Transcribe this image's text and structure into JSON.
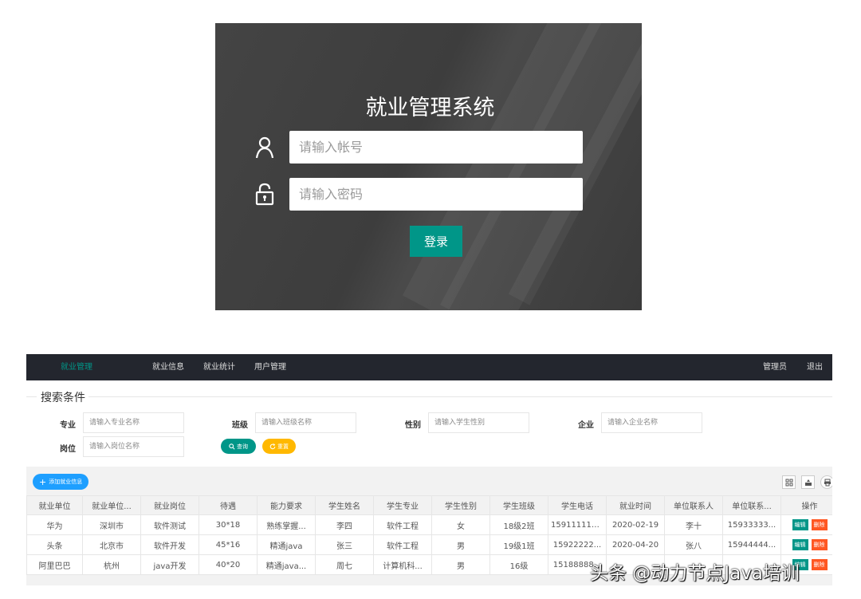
{
  "login": {
    "title": "就业管理系统",
    "username_placeholder": "请输入帐号",
    "password_placeholder": "请输入密码",
    "login_label": "登录"
  },
  "nav": {
    "brand": "就业管理",
    "items": [
      "就业信息",
      "就业统计",
      "用户管理"
    ],
    "user": "管理员",
    "logout": "退出"
  },
  "search": {
    "section_title": "搜索条件",
    "fields": [
      {
        "label": "专业",
        "placeholder": "请输入专业名称"
      },
      {
        "label": "班级",
        "placeholder": "请输入班级名称"
      },
      {
        "label": "性别",
        "placeholder": "请输入学生性别"
      },
      {
        "label": "企业",
        "placeholder": "请输入企业名称"
      },
      {
        "label": "岗位",
        "placeholder": "请输入岗位名称"
      }
    ],
    "query_label": "查询",
    "reset_label": "重置"
  },
  "table": {
    "add_label": "添加就业信息",
    "headers": [
      "就业单位",
      "就业单位...",
      "就业岗位",
      "待遇",
      "能力要求",
      "学生姓名",
      "学生专业",
      "学生性别",
      "学生班级",
      "学生电话",
      "就业时间",
      "单位联系人",
      "单位联系...",
      "操作"
    ],
    "rows": [
      [
        "华为",
        "深圳市",
        "软件测试",
        "30*18",
        "熟练掌握...",
        "李四",
        "软件工程",
        "女",
        "18级2班",
        "159111111...",
        "2020-02-19",
        "李十",
        "15933333..."
      ],
      [
        "头条",
        "北京市",
        "软件开发",
        "45*16",
        "精通java",
        "张三",
        "软件工程",
        "男",
        "19级1班",
        "15922222...",
        "2020-04-20",
        "张八",
        "15944444..."
      ],
      [
        "阿里巴巴",
        "杭州",
        "java开发",
        "40*20",
        "精通java...",
        "周七",
        "计算机科...",
        "男",
        "16级",
        "15188888...",
        "",
        "",
        ""
      ]
    ],
    "edit_label": "编辑",
    "delete_label": "删除"
  },
  "colors": {
    "brand_green": "#009688",
    "blue": "#1e9fff",
    "orange": "#ffb800",
    "red": "#ff5722",
    "topbar": "#23262e"
  },
  "watermark": "头条 @动力节点Java培训"
}
